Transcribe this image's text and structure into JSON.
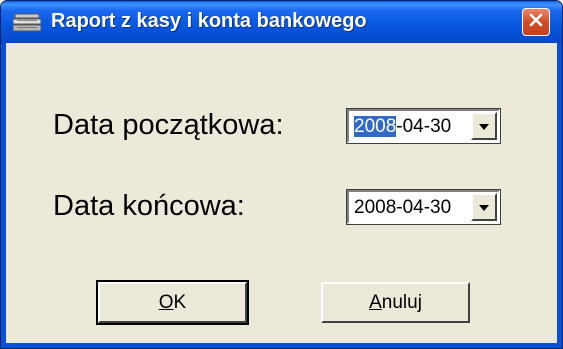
{
  "window": {
    "title": "Raport z kasy i konta bankowego",
    "icon": "cash-register-icon",
    "close_icon": "close-icon"
  },
  "form": {
    "start_label": "Data początkowa:",
    "end_label": "Data końcowa:",
    "start_date": {
      "selected_part": "2008",
      "rest": "-04-30"
    },
    "end_date": "2008-04-30"
  },
  "buttons": {
    "ok": {
      "mnemonic": "O",
      "rest": "K"
    },
    "cancel": {
      "mnemonic": "A",
      "rest": "nuluj"
    }
  },
  "colors": {
    "titlebar": "#0858e0",
    "close_button": "#d6502a",
    "dialog_face": "#ece9d8",
    "selection": "#316ac5"
  }
}
